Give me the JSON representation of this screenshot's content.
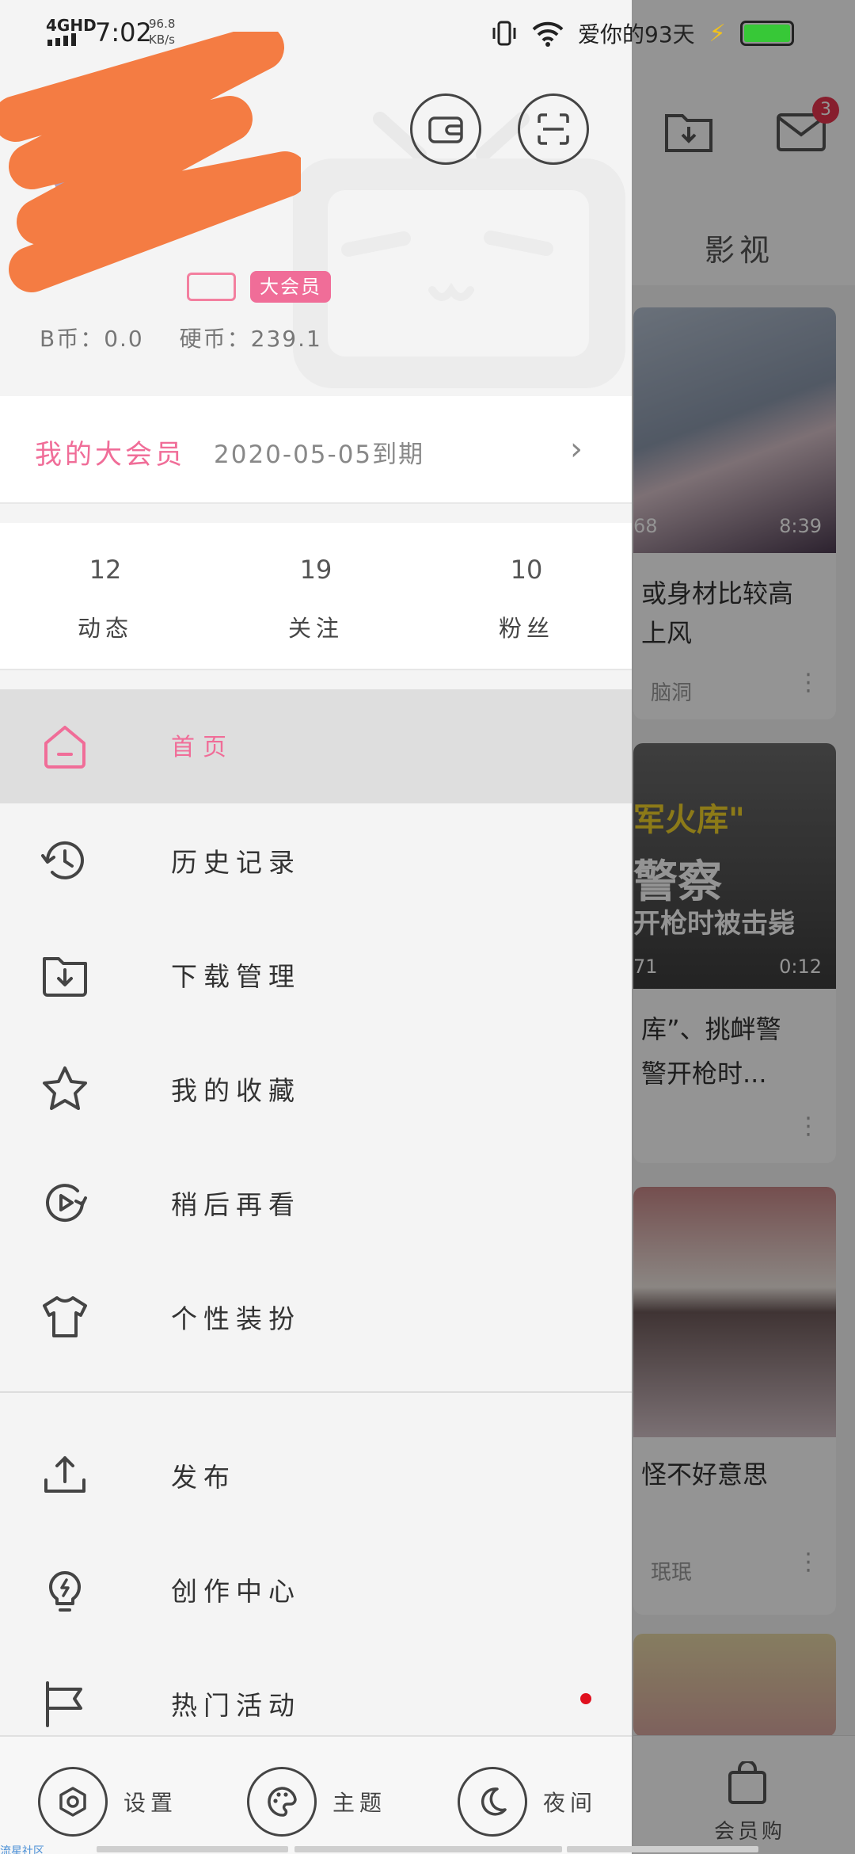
{
  "status_bar": {
    "network": "4GHD",
    "time": "7:02",
    "speed_value": "96.8",
    "speed_unit": "KB/s",
    "carrier": "爱你的93天",
    "battery_color": "#37c837"
  },
  "background": {
    "tab_label": "影视",
    "inbox_badge": "3",
    "cards": [
      {
        "duration": "8:39",
        "counter": "68",
        "title_line1": "或身材比较高",
        "title_line2": "上风",
        "author": "脑洞"
      },
      {
        "duration": "0:12",
        "counter": "71",
        "overlay_line1": "军火库\"",
        "overlay_line2": "警察",
        "overlay_line3": "开枪时被击毙",
        "title_line1": "库”、挑衅警",
        "title_line2": "警开枪时..."
      },
      {
        "title_line1": "怪不好意思",
        "author": "珉珉"
      }
    ],
    "bottom_label": "会员购"
  },
  "profile": {
    "vip_badge_char": "大",
    "member_tag": "大会员",
    "b_coins": "B币：0.0",
    "hard_coins": "硬币：239.1"
  },
  "vip": {
    "label": "我的大会员",
    "expire": "2020-05-05到期"
  },
  "stats": [
    {
      "num": "12",
      "label": "动态"
    },
    {
      "num": "19",
      "label": "关注"
    },
    {
      "num": "10",
      "label": "粉丝"
    }
  ],
  "menu": [
    {
      "label": "首页",
      "icon": "home-icon"
    },
    {
      "label": "历史记录",
      "icon": "history-icon"
    },
    {
      "label": "下载管理",
      "icon": "download-folder-icon"
    },
    {
      "label": "我的收藏",
      "icon": "star-icon"
    },
    {
      "label": "稍后再看",
      "icon": "watch-later-icon"
    },
    {
      "label": "个性装扮",
      "icon": "tshirt-icon"
    },
    {
      "label": "发布",
      "icon": "upload-icon"
    },
    {
      "label": "创作中心",
      "icon": "bulb-icon"
    },
    {
      "label": "热门活动",
      "icon": "flag-icon"
    }
  ],
  "bottom_bar": {
    "settings": "设置",
    "theme": "主题",
    "night": "夜间"
  },
  "footer_tag": "流星社区",
  "colors": {
    "accent": "#f06d98",
    "scribble": "#f47c43",
    "active_row": "#dedede",
    "notification_dot": "#e0101e"
  }
}
